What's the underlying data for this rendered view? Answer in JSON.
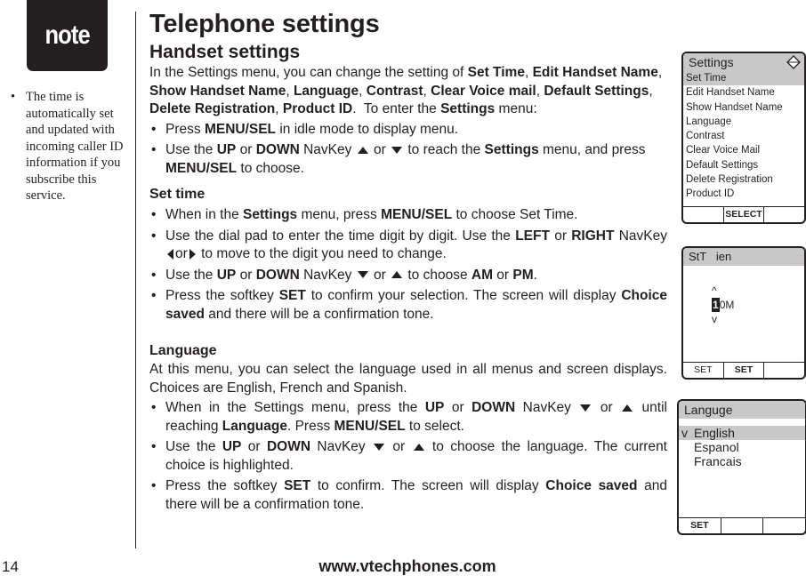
{
  "sidebar": {
    "badge_label": "note",
    "note_items": [
      "The time is automatically set and updated with incoming caller ID information if you subscribe this service."
    ]
  },
  "page": {
    "title": "Telephone settings",
    "subtitle": "Handset settings",
    "page_number": "14",
    "footer_url": "www.vtechphones.com"
  },
  "intro": {
    "text_start": "In the Settings menu, you can change the setting of ",
    "items": [
      "Set Time",
      "Edit Handset Name",
      "Show Handset Name",
      "Language",
      "Contrast",
      "Clear Voice mail",
      "Default Settings",
      "Delete Registration",
      "Product ID"
    ],
    "text_end": "To enter the ",
    "settings_word": "Settings",
    "menu_word": " menu:",
    "bullets": [
      {
        "pre": "Press ",
        "b1": "MENU/SEL",
        "post": " in idle mode to display menu."
      },
      {
        "pre": "Use the ",
        "b1": "UP",
        "mid1": " or ",
        "b2": "DOWN",
        "mid2": " NavKey ",
        "or": " or ",
        "mid3": " to reach the ",
        "b3": "Settings",
        "mid4": " menu, and press ",
        "b4": "MENU/SEL",
        "post": " to choose."
      }
    ]
  },
  "set_time": {
    "heading": "Set time",
    "bullets": [
      {
        "pre": "When in the ",
        "b1": "Settings",
        "mid1": " menu, press ",
        "b2": "MENU/SEL",
        "post": " to choose Set Time."
      },
      {
        "pre": "Use the dial pad to enter the time digit by digit. Use the ",
        "b1": "LEFT",
        "mid1": " or ",
        "b2": "RIGHT",
        "mid2": " NavKey ",
        "or": "or",
        "post": " to move to the digit you need to change."
      },
      {
        "pre": "Use the ",
        "b1": "UP",
        "mid1": " or ",
        "b2": "DOWN",
        "mid2": " NavKey ",
        "or": " or ",
        "mid3": " to choose ",
        "b3": "AM",
        "mid4": " or ",
        "b4": "PM",
        "post": "."
      },
      {
        "pre": "Press the softkey ",
        "b1": "SET",
        "mid1": " to confirm your selection. The screen will display ",
        "b2": "Choice saved",
        "post": " and there will be a confirmation tone."
      }
    ]
  },
  "language": {
    "heading": "Language",
    "para": "At this menu, you can select the language used in all menus and screen displays. Choices are English, French and Spanish.",
    "bullets": [
      {
        "pre": "When in the Settings menu, press the ",
        "b1": "UP",
        "mid1": " or ",
        "b2": "DOWN",
        "mid2": " NavKey ",
        "or": " or ",
        "mid3": " until reaching ",
        "b3": "Language",
        "mid4": ". Press ",
        "b4": "MENU/SEL",
        "post": " to select."
      },
      {
        "pre": "Use the ",
        "b1": "UP",
        "mid1": " or ",
        "b2": "DOWN",
        "mid2": " NavKey ",
        "or": " or ",
        "post": " to choose the language. The current choice is highlighted."
      },
      {
        "pre": "Press the softkey ",
        "b1": "SET",
        "mid1": " to confirm. The screen will display ",
        "b2": "Choice saved",
        "post": " and there will be a confirmation tone."
      }
    ]
  },
  "screen_settings": {
    "title": "Settings",
    "items": [
      "Set Time",
      "Edit Handset Name",
      "Show Handset Name",
      "Language",
      "Contrast",
      "Clear Voice Mail",
      "Default Settings",
      "Delete Registration",
      "Product ID"
    ],
    "selected_index": 0,
    "softkeys": [
      "",
      "SELECT",
      ""
    ]
  },
  "screen_set_time": {
    "title": "StT   ien",
    "up_arrow": "^",
    "digit": "1",
    "value_rest": "0M",
    "down_arrow": "v",
    "softkeys": [
      "SET",
      "SET",
      ""
    ]
  },
  "screen_language": {
    "title": "Languge",
    "options": [
      "English",
      "Espanol",
      "Francais"
    ],
    "selected_index": 0,
    "check_mark": "v",
    "softkeys": [
      "SET",
      "",
      ""
    ]
  }
}
